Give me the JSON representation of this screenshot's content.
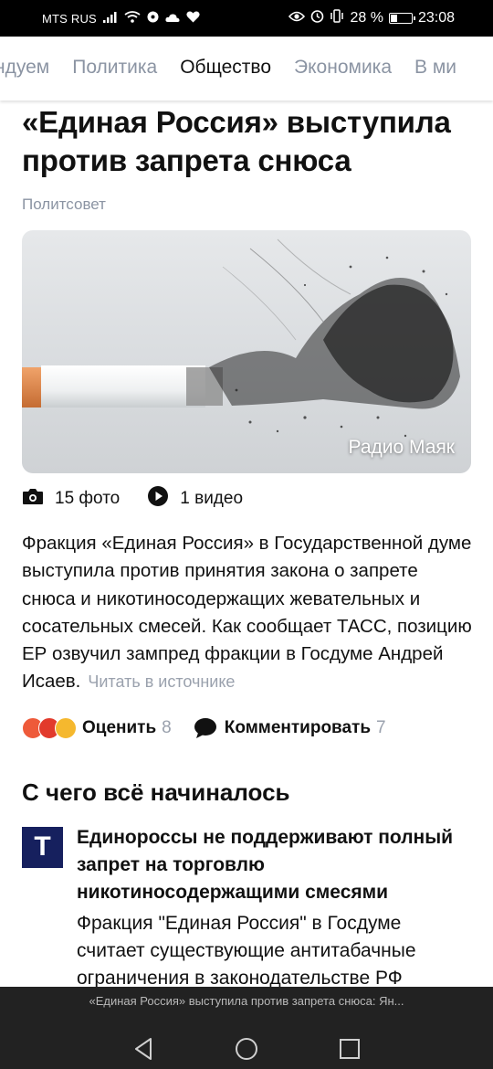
{
  "status_bar": {
    "carrier": "MTS RUS",
    "battery": "28 %",
    "battery_level": 0.28,
    "time": "23:08"
  },
  "tabs": [
    {
      "label": "ндуем",
      "active": false
    },
    {
      "label": "Политика",
      "active": false
    },
    {
      "label": "Общество",
      "active": true
    },
    {
      "label": "Экономика",
      "active": false
    },
    {
      "label": "В ми",
      "active": false
    }
  ],
  "article": {
    "headline": "«Единая Россия» выступила против запрета снюса",
    "source": "Политсовет",
    "hero_caption": "Радио Маяк",
    "photos": "15 фото",
    "videos": "1 видео",
    "body": "Фракция «Единая Россия» в Государственной думе выступила против принятия закона о запрете снюса и никотиносодержащих жевательных и сосательных смесей. Как сообщает ТАСС, позицию ЕР озвучил зампред фракции в Госдуме Андрей Исаев.",
    "read_source": "Читать в источнике"
  },
  "actions": {
    "rate_label": "Оценить",
    "rate_count": "8",
    "comment_label": "Комментировать",
    "comment_count": "7"
  },
  "related_section": {
    "title": "С чего всё начиналось",
    "item": {
      "logo_letter": "T",
      "title": "Единороссы не поддерживают полный запрет на торговлю никотиносодержащими смесями",
      "snippet": "Фракция \"Единая Россия\" в Госдуме считает существующие антитабачные ограничения в законодательстве РФ"
    }
  },
  "bottom_bar": {
    "page_title": "«Единая Россия» выступила против запрета снюса: Ян..."
  },
  "colors": {
    "accent_inactive": "#8b94a3",
    "logo_bg": "#16205e",
    "nav_bg": "#222222"
  },
  "icons": [
    "signal-icon",
    "wifi-icon",
    "eye-icon",
    "alarm-icon",
    "vibrate-icon",
    "camera-icon",
    "play-icon",
    "comment-icon",
    "back-icon",
    "home-icon",
    "recents-icon"
  ]
}
